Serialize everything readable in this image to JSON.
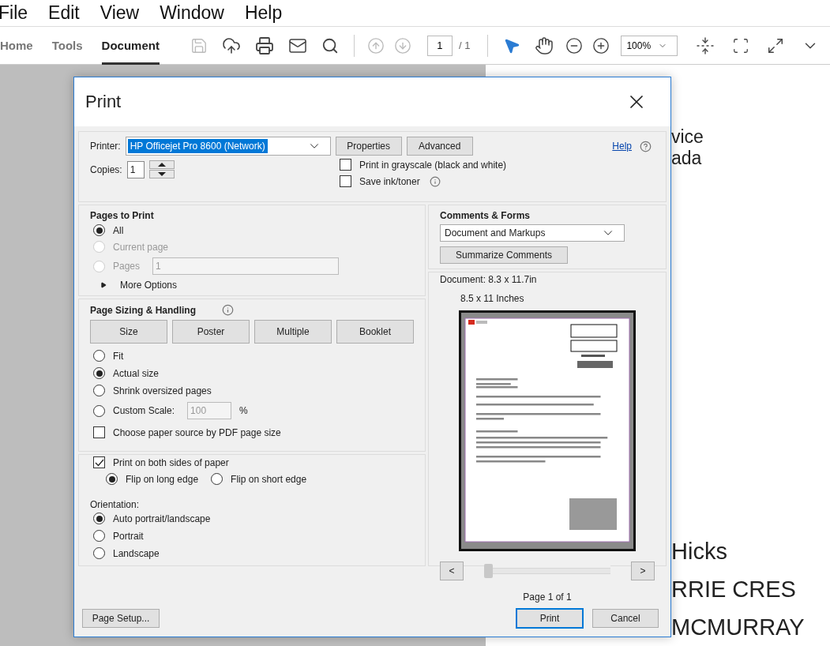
{
  "menu": [
    "File",
    "Edit",
    "View",
    "Window",
    "Help"
  ],
  "tabs": [
    {
      "label": "Home",
      "selected": false
    },
    {
      "label": "Tools",
      "selected": false
    },
    {
      "label": "Document",
      "selected": true
    }
  ],
  "toolbar": {
    "page_number": "1",
    "page_total": "/ 1",
    "zoom": "100%"
  },
  "document_text": [
    {
      "text": "vice",
      "kind": "small"
    },
    {
      "text": "ada",
      "kind": "small"
    },
    {
      "text": "Hicks",
      "kind": "large"
    },
    {
      "text": "RRIE CRES",
      "kind": "large"
    },
    {
      "text": "MCMURRAY",
      "kind": "large"
    }
  ],
  "dialog": {
    "title": "Print",
    "printer_label": "Printer:",
    "printer": "HP Officejet Pro 8600 (Network)",
    "properties": "Properties",
    "advanced": "Advanced",
    "help": "Help",
    "copies_label": "Copies:",
    "copies": "1",
    "options": [
      {
        "label": "Print in grayscale (black and white)",
        "checked": false,
        "kind": "plain"
      },
      {
        "label": "Save ink/toner",
        "checked": false,
        "kind": "info"
      }
    ],
    "pages_to_print": {
      "title": "Pages to Print",
      "choices": [
        {
          "label": "All",
          "selected": true,
          "disabled": false
        },
        {
          "label": "Current page",
          "selected": false,
          "disabled": true
        },
        {
          "label": "Pages",
          "selected": false,
          "disabled": true,
          "field": "1"
        }
      ],
      "more": "More Options"
    },
    "sizing": {
      "title": "Page Sizing & Handling",
      "modes": [
        "Size",
        "Poster",
        "Multiple",
        "Booklet"
      ],
      "choices": [
        {
          "label": "Fit",
          "selected": false
        },
        {
          "label": "Actual size",
          "selected": true
        },
        {
          "label": "Shrink oversized pages",
          "selected": false
        },
        {
          "label": "Custom Scale:",
          "selected": false,
          "field": "100",
          "unit": "%"
        }
      ],
      "paper_source": {
        "label": "Choose paper source by PDF page size",
        "checked": false
      }
    },
    "duplex": {
      "label": "Print on both sides of paper",
      "checked": true,
      "choices": [
        {
          "label": "Flip on long edge",
          "selected": true
        },
        {
          "label": "Flip on short edge",
          "selected": false
        }
      ]
    },
    "orientation": {
      "title": "Orientation:",
      "choices": [
        {
          "label": "Auto portrait/landscape",
          "selected": true
        },
        {
          "label": "Portrait",
          "selected": false
        },
        {
          "label": "Landscape",
          "selected": false
        }
      ]
    },
    "comments": {
      "title": "Comments & Forms",
      "value": "Document and Markups",
      "summarize": "Summarize Comments"
    },
    "preview": {
      "document_size": "Document: 8.3 x 11.7in",
      "paper_size": "8.5 x 11 Inches",
      "prev": "<",
      "next": ">",
      "level": 0,
      "page_label": "Page 1 of 1"
    },
    "page_setup": "Page Setup...",
    "print": "Print",
    "cancel": "Cancel"
  }
}
